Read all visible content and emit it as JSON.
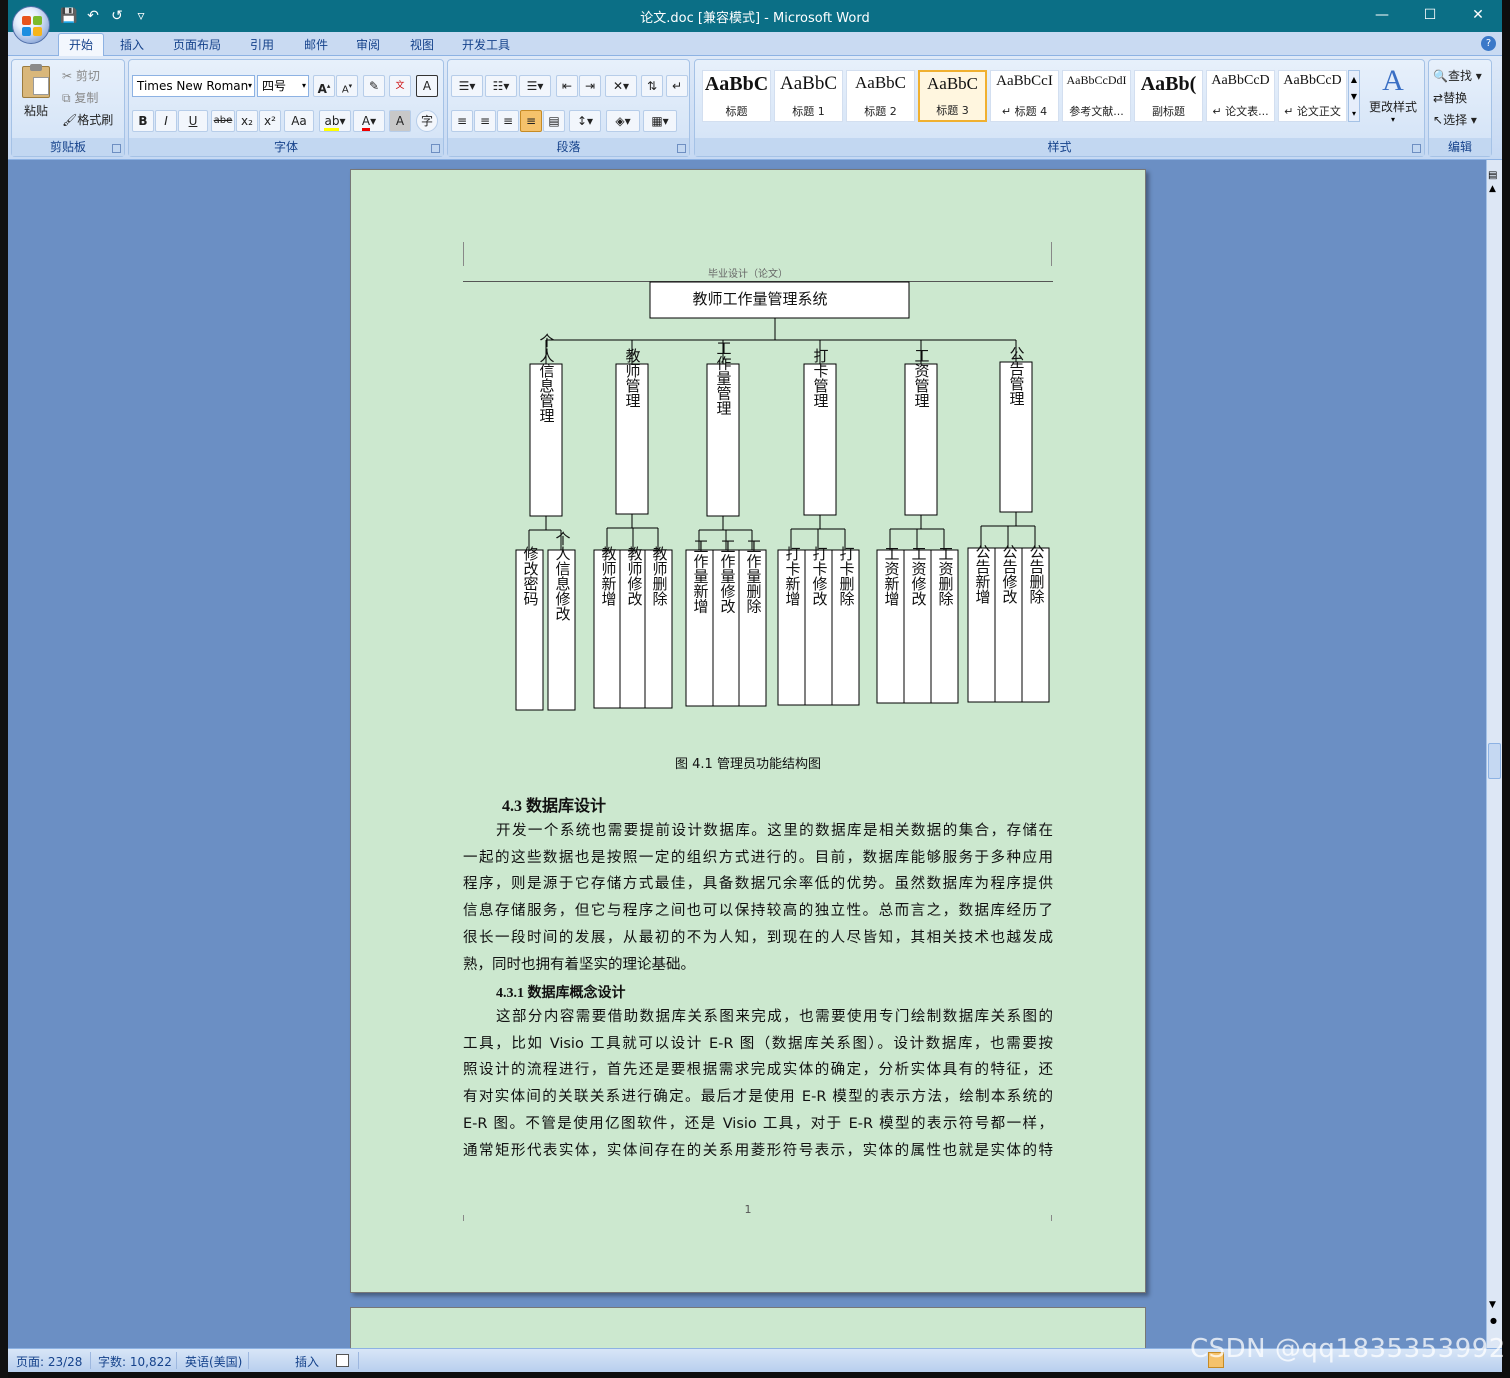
{
  "window": {
    "title": "论文.doc [兼容模式] - Microsoft Word"
  },
  "qat": {
    "save": "💾",
    "undo": "↶",
    "redo": "↺",
    "more": "▿"
  },
  "tabs": [
    "开始",
    "插入",
    "页面布局",
    "引用",
    "邮件",
    "审阅",
    "视图",
    "开发工具"
  ],
  "clipboard": {
    "paste": "粘贴",
    "cut": "剪切",
    "copy": "复制",
    "format_painter": "格式刷",
    "label": "剪贴板"
  },
  "font": {
    "name": "Times New Roman",
    "size": "四号",
    "label": "字体",
    "bold": "B",
    "italic": "I",
    "underline": "U",
    "strike": "abe",
    "sub": "x₂",
    "sup": "x²",
    "case": "Aa",
    "grow": "A",
    "shrink": "A",
    "clear": "A",
    "wen": "wén",
    "box": "A",
    "color_a": "A",
    "char_a": "A",
    "circle": "字"
  },
  "paragraph": {
    "label": "段落"
  },
  "styles": {
    "label": "样式",
    "change": "更改样式",
    "items": [
      {
        "sample": "AaBbC",
        "name": "标题",
        "size": 20,
        "bold": true
      },
      {
        "sample": "AaBbC",
        "name": "标题 1",
        "size": 19,
        "bold": false
      },
      {
        "sample": "AaBbC",
        "name": "标题 2",
        "size": 17,
        "bold": false
      },
      {
        "sample": "AaBbC",
        "name": "标题 3",
        "size": 17,
        "bold": false
      },
      {
        "sample": "AaBbCcI",
        "name": "↵ 标题 4",
        "size": 15,
        "bold": false
      },
      {
        "sample": "AaBbCcDdI",
        "name": "参考文献...",
        "size": 12,
        "bold": false
      },
      {
        "sample": "AaBb(",
        "name": "副标题",
        "size": 20,
        "bold": true
      },
      {
        "sample": "AaBbCcD",
        "name": "↵ 论文表...",
        "size": 14,
        "bold": false
      },
      {
        "sample": "AaBbCcD",
        "name": "↵ 论文正文",
        "size": 14,
        "bold": false
      }
    ]
  },
  "editing": {
    "label": "编辑",
    "find": "查找",
    "replace": "替换",
    "select": "选择"
  },
  "document": {
    "header": "毕业设计（论文）",
    "chart": {
      "root": "教师工作量管理系统",
      "modules": [
        {
          "name": "个人信息管理",
          "children": [
            "修改密码",
            "个人信息修改"
          ]
        },
        {
          "name": "教师管理",
          "children": [
            "教师新增",
            "教师修改",
            "教师删除"
          ]
        },
        {
          "name": "工作量管理",
          "children": [
            "工作量新增",
            "工作量修改",
            "工作量删除"
          ]
        },
        {
          "name": "打卡管理",
          "children": [
            "打卡新增",
            "打卡修改",
            "打卡删除"
          ]
        },
        {
          "name": "工资管理",
          "children": [
            "工资新增",
            "工资修改",
            "工资删除"
          ]
        },
        {
          "name": "公告管理",
          "children": [
            "公告新增",
            "公告修改",
            "公告删除"
          ]
        }
      ]
    },
    "caption": "图 4.1  管理员功能结构图",
    "h2": "4.3 数据库设计",
    "p1": [
      "开发一个系统也需要提前设计数据库。这里的数据库是相关数据的集合，存储在",
      "一起的这些数据也是按照一定的组织方式进行的。目前，数据库能够服务于多种应用",
      "程序，则是源于它存储方式最佳，具备数据冗余率低的优势。虽然数据库为程序提供",
      "信息存储服务，但它与程序之间也可以保持较高的独立性。总而言之，数据库经历了",
      "很长一段时间的发展，从最初的不为人知，到现在的人尽皆知，其相关技术也越发成",
      "熟，同时也拥有着坚实的理论基础。"
    ],
    "h3": "4.3.1 数据库概念设计",
    "p2": [
      "这部分内容需要借助数据库关系图来完成，也需要使用专门绘制数据库关系图的",
      "工具，比如 Visio 工具就可以设计 E-R 图（数据库关系图）。设计数据库，也需要按",
      "照设计的流程进行，首先还是要根据需求完成实体的确定，分析实体具有的特征，还",
      "有对实体间的关联关系进行确定。最后才是使用 E-R 模型的表示方法，绘制本系统的",
      "E-R 图。不管是使用亿图软件，还是 Visio 工具，对于 E-R 模型的表示符号都一样，",
      "通常矩形代表实体，实体间存在的关系用菱形符号表示，实体的属性也就是实体的特"
    ],
    "page_number": "1"
  },
  "status": {
    "page": "页面: 23/28",
    "words": "字数: 10,822",
    "lang": "英语(美国)",
    "mode": "插入"
  },
  "watermark": "CSDN @qq1835353992"
}
